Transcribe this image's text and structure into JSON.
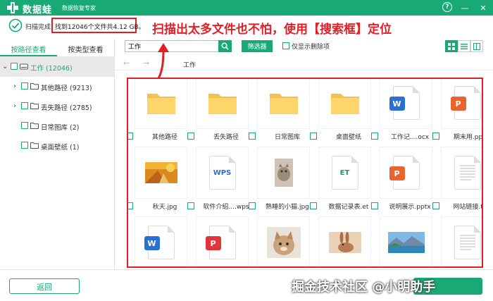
{
  "app": {
    "name": "数据蛙",
    "subtitle": "数据恢复专家"
  },
  "status": {
    "scan_done": "扫描完成,",
    "found": "找到12046个文件共4.12 GB。"
  },
  "annotation": "扫描出太多文件也不怕，使用【搜索框】定位",
  "sidebar": {
    "tabs": [
      {
        "label": "按路径查看"
      },
      {
        "label": "按类型查看"
      }
    ],
    "tree": [
      {
        "label": "工作 (12046)"
      },
      {
        "label": "其他路径 (9213)"
      },
      {
        "label": "丢失路径 (2785)"
      },
      {
        "label": "日常图库 (2)"
      },
      {
        "label": "桌面壁纸 (1)"
      }
    ]
  },
  "toolbar": {
    "search_value": "工作",
    "filter_label": "筛选器",
    "show_deleted_label": "仅显示删除项"
  },
  "path": {
    "current": "工作"
  },
  "files": [
    {
      "name": "其他路径",
      "kind": "folder"
    },
    {
      "name": "丢失路径",
      "kind": "folder"
    },
    {
      "name": "日常图库",
      "kind": "folder"
    },
    {
      "name": "桌面壁纸",
      "kind": "folder"
    },
    {
      "name": "工作记....ocx",
      "kind": "word"
    },
    {
      "name": "期末用.pptx",
      "kind": "ppt"
    },
    {
      "name": "秋天.jpg",
      "kind": "photo-autumn"
    },
    {
      "name": "软件介绍....wps",
      "kind": "wps"
    },
    {
      "name": "熟睡的小猫.jpg",
      "kind": "photo-cat"
    },
    {
      "name": "数据记录表.et",
      "kind": "et"
    },
    {
      "name": "说明展示.pptx",
      "kind": "ppt"
    },
    {
      "name": "网站链接.txt",
      "kind": "txt"
    },
    {
      "name": "",
      "kind": "word"
    },
    {
      "name": "",
      "kind": "pdf"
    },
    {
      "name": "",
      "kind": "photo-cat2"
    },
    {
      "name": "",
      "kind": "photo-rabbit"
    },
    {
      "name": "",
      "kind": "photo-lake"
    },
    {
      "name": "",
      "kind": "txt"
    }
  ],
  "buttons": {
    "back": "返回"
  },
  "watermark": "掘金技术社区 @小明助手",
  "colors": {
    "brand": "#19a974",
    "annotation": "#e01e24"
  }
}
